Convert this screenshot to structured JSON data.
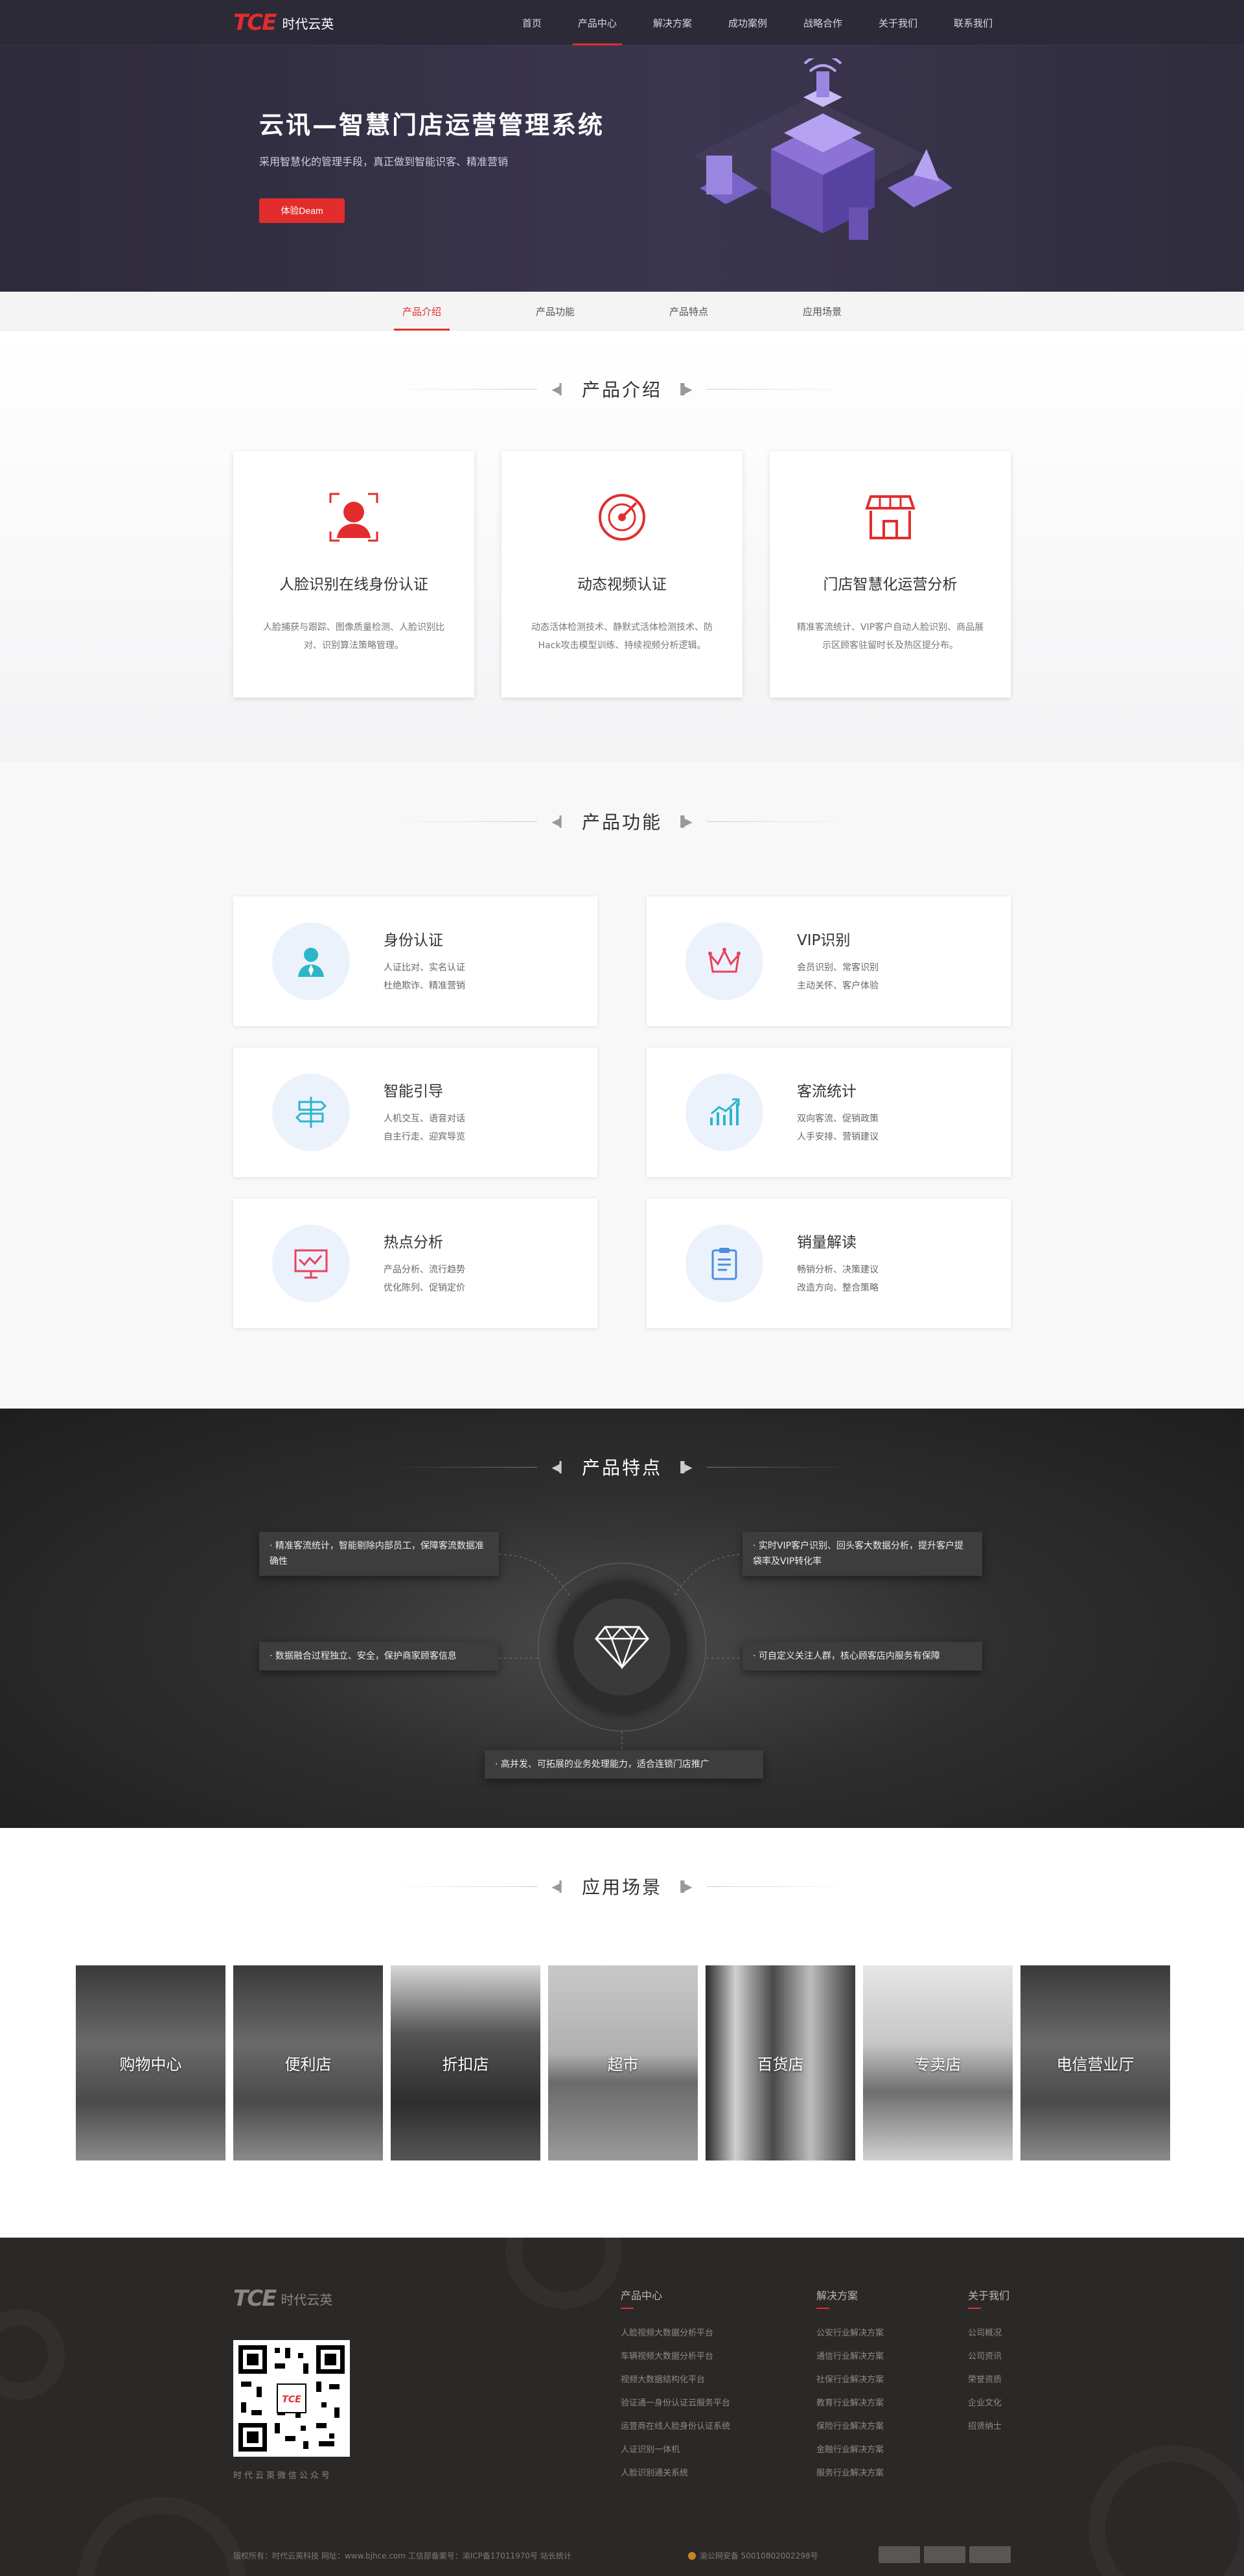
{
  "header": {
    "logo_tce": "TCE",
    "logo_cn": "时代云英",
    "nav": [
      "首页",
      "产品中心",
      "解决方案",
      "成功案例",
      "战略合作",
      "关于我们",
      "联系我们"
    ],
    "active_nav": "产品中心"
  },
  "hero": {
    "title": "云讯—智慧门店运营管理系统",
    "subtitle": "采用智慧化的管理手段，真正做到智能识客、精准营销",
    "button": "体验Deam"
  },
  "subnav": {
    "items": [
      "产品介绍",
      "产品功能",
      "产品特点",
      "应用场景"
    ],
    "active": "产品介绍"
  },
  "intro": {
    "title": "产品介绍",
    "cards": [
      {
        "icon": "face-scan-icon",
        "title": "人脸识别在线身份认证",
        "desc": "人脸捕获与跟踪、图像质量检测、人脸识别比对、识别算法策略管理。"
      },
      {
        "icon": "radar-video-icon",
        "title": "动态视频认证",
        "desc": "动态活体检测技术、静默式活体检测技术、防Hack攻击模型训练、持续视频分析逻辑。"
      },
      {
        "icon": "store-icon",
        "title": "门店智慧化运营分析",
        "desc": "精准客流统计、VIP客户自动人脸识别、商品展示区顾客驻留时长及热区提分布。"
      }
    ]
  },
  "func": {
    "title": "产品功能",
    "items": [
      {
        "icon": "person-id-icon",
        "title": "身份认证",
        "l1": "人证比对、实名认证",
        "l2": "杜绝欺诈、精准营销"
      },
      {
        "icon": "crown-icon",
        "title": "VIP识别",
        "l1": "会员识别、常客识别",
        "l2": "主动关怀、客户体验"
      },
      {
        "icon": "signpost-icon",
        "title": "智能引导",
        "l1": "人机交互、语音对话",
        "l2": "自主行走、迎宾导览"
      },
      {
        "icon": "growth-chart-icon",
        "title": "客流统计",
        "l1": "双向客流、促销政策",
        "l2": "人手安排、营销建议"
      },
      {
        "icon": "heat-monitor-icon",
        "title": "热点分析",
        "l1": "产品分析、流行趋势",
        "l2": "优化陈列、促销定价"
      },
      {
        "icon": "clipboard-icon",
        "title": "销量解读",
        "l1": "畅销分析、决策建议",
        "l2": "改造方向、整合策略"
      }
    ]
  },
  "feat": {
    "title": "产品特点",
    "items": [
      "· 精准客流统计，智能剔除内部员工，保障客流数据准确性",
      "· 实时VIP客户识别、回头客大数据分析，提升客户提袋率及VIP转化率",
      "· 数据融合过程独立、安全，保护商家顾客信息",
      "· 可自定义关注人群，核心顾客店内服务有保障",
      "· 高并发、可拓展的业务处理能力，适合连锁门店推广"
    ],
    "center_icon": "diamond-icon"
  },
  "scene": {
    "title": "应用场景",
    "items": [
      "购物中心",
      "便利店",
      "折扣店",
      "超市",
      "百货店",
      "专卖店",
      "电信营业厅"
    ]
  },
  "footer": {
    "logo_tce": "TCE",
    "logo_cn": "时代云英",
    "qr_caption": "时代云英微信公众号",
    "qr_text": "TCE",
    "cols": [
      {
        "title": "产品中心",
        "links": [
          "人脸视频大数据分析平台",
          "车辆视频大数据分析平台",
          "视频大数据结构化平台",
          "验证通一身份认证云服务平台",
          "运营商在线人脸身份认证系统",
          "人证识别一体机",
          "人脸识别通关系统"
        ]
      },
      {
        "title": "解决方案",
        "links": [
          "公安行业解决方案",
          "通信行业解决方案",
          "社保行业解决方案",
          "教育行业解决方案",
          "保险行业解决方案",
          "金融行业解决方案",
          "服务行业解决方案"
        ]
      },
      {
        "title": "关于我们",
        "links": [
          "公司概况",
          "公司资讯",
          "荣誉资质",
          "企业文化",
          "招贤纳士"
        ]
      }
    ],
    "copyright": "版权所有：时代云英科技    网址：www.bjhce.com    工信部备案号：渝ICP备17011970号  站长统计",
    "police": "渝公网安备 50010802002298号"
  },
  "colors": {
    "accent": "#e32d2d",
    "header_bg": "#2c2a37",
    "footer_bg": "#2b2828"
  }
}
